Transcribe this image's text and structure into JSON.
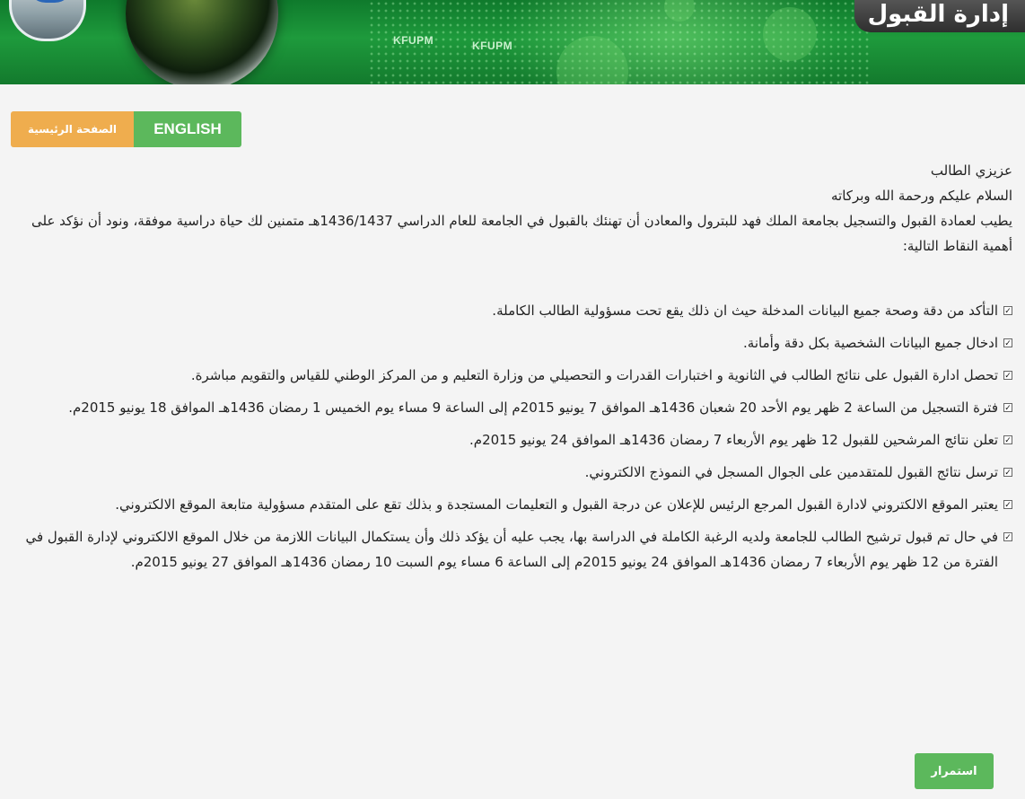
{
  "banner": {
    "title": "إدارة القبول",
    "watermarks": [
      "KFUPM",
      "KFUPM"
    ]
  },
  "nav": {
    "home_label": "الصفحة الرئيسية",
    "english_label": "ENGLISH"
  },
  "intro": {
    "greeting": "عزيزي الطالب",
    "salam": "السلام عليكم ورحمة الله وبركاته",
    "body": "يطيب لعمادة القبول والتسجيل بجامعة الملك فهد للبترول والمعادن أن تهنئك بالقبول في الجامعة للعام الدراسي 1436/1437هـ متمنين لك حياة دراسية موفقة، ونود أن نؤكد على أهمية النقاط التالية:"
  },
  "items": [
    "التأكد من دقة وصحة جميع البيانات المدخلة حيث ان ذلك يقع تحت مسؤولية الطالب الكاملة.",
    "ادخال جميع البيانات الشخصية بكل دقة وأمانة.",
    "تحصل ادارة القبول على نتائج الطالب في الثانوية و اختبارات القدرات و التحصيلي من وزارة التعليم و من المركز الوطني للقياس والتقويم مباشرة.",
    "فترة التسجيل من الساعة 2 ظهر يوم الأحد 20 شعبان 1436هـ الموافق 7 يونيو 2015م إلى الساعة 9 مساء يوم الخميس 1 رمضان 1436هـ الموافق 18 يونيو 2015م.",
    "تعلن نتائج المرشحين للقبول 12 ظهر يوم الأربعاء 7 رمضان 1436هـ الموافق 24 يونيو 2015م.",
    "ترسل نتائج القبول للمتقدمين على الجوال المسجل في النموذج الالكتروني.",
    "يعتبر الموقع الالكتروني لادارة القبول المرجع الرئيس للإعلان عن درجة القبول و التعليمات المستجدة و بذلك تقع على المتقدم مسؤولية متابعة الموقع الالكتروني.",
    "في حال تم قبول ترشيح الطالب للجامعة ولديه الرغبة الكاملة في الدراسة بها، يجب عليه أن يؤكد ذلك وأن يستكمال البيانات اللازمة من خلال الموقع الالكتروني لإدارة القبول في الفترة من 12 ظهر يوم الأربعاء 7 رمضان 1436هـ الموافق 24 يونيو 2015م إلى الساعة 6 مساء يوم السبت 10 رمضان 1436هـ الموافق 27 يونيو 2015م."
  ],
  "actions": {
    "continue_label": "استمرار"
  },
  "colors": {
    "banner_green": "#1e9a3c",
    "home_button": "#efad4e",
    "english_button": "#5cb85c",
    "continue_button": "#5cb85c"
  }
}
